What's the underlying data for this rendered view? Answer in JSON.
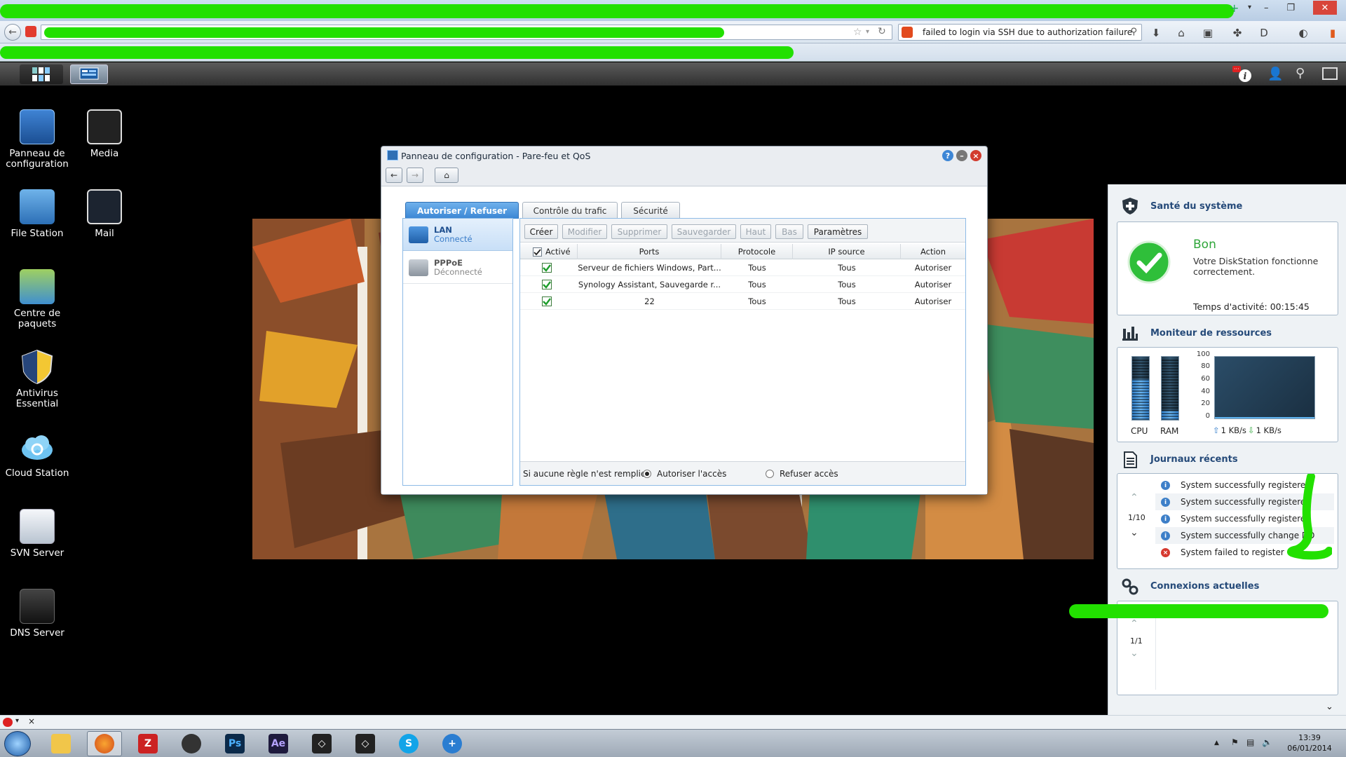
{
  "browser": {
    "search_value": "failed to login via SSH due to authorization failure",
    "close_glyph": "✕",
    "min_glyph": "–",
    "max_glyph": "❐"
  },
  "dsm": {
    "notification_count": "···"
  },
  "desktop_icons": [
    {
      "label": "Panneau de configuration"
    },
    {
      "label": "Media"
    },
    {
      "label": "File Station"
    },
    {
      "label": "Mail"
    },
    {
      "label": "Centre de paquets"
    },
    {
      "label": "Antivirus Essential"
    },
    {
      "label": "Cloud Station"
    },
    {
      "label": "SVN Server"
    },
    {
      "label": "DNS Server"
    }
  ],
  "dialog": {
    "title": "Panneau de configuration - Pare-feu et QoS",
    "tabs": [
      "Autoriser / Refuser",
      "Contrôle du trafic",
      "Sécurité"
    ],
    "interfaces": [
      {
        "name": "LAN",
        "status": "Connecté"
      },
      {
        "name": "PPPoE",
        "status": "Déconnecté"
      }
    ],
    "toolbar": {
      "create": "Créer",
      "edit": "Modifier",
      "delete": "Supprimer",
      "save": "Sauvegarder",
      "up": "Haut",
      "down": "Bas",
      "settings": "Paramètres"
    },
    "columns": {
      "enabled": "Activé",
      "ports": "Ports",
      "protocol": "Protocole",
      "source_ip": "IP source",
      "action": "Action"
    },
    "rules": [
      {
        "ports": "Serveur de fichiers Windows, Part...",
        "protocol": "Tous",
        "source_ip": "Tous",
        "action": "Autoriser"
      },
      {
        "ports": "Synology Assistant, Sauvegarde r...",
        "protocol": "Tous",
        "source_ip": "Tous",
        "action": "Autoriser"
      },
      {
        "ports": "22",
        "protocol": "Tous",
        "source_ip": "Tous",
        "action": "Autoriser"
      }
    ],
    "footer": {
      "label": "Si aucune règle n'est remplie:",
      "allow": "Autoriser l'accès",
      "deny": "Refuser accès"
    }
  },
  "widgets": {
    "health": {
      "title": "Santé du système",
      "status": "Bon",
      "message": "Votre DiskStation fonctionne correctement.",
      "uptime": "Temps d'activité: 00:15:45"
    },
    "resources": {
      "title": "Moniteur de ressources",
      "cpu_label": "CPU",
      "ram_label": "RAM",
      "cpu_level": 0.65,
      "ram_level": 0.15,
      "axis_ticks": [
        "100",
        "80",
        "60",
        "40",
        "20",
        "0"
      ],
      "upload": "1 KB/s",
      "download": "1 KB/s"
    },
    "logs": {
      "title": "Journaux récents",
      "page": "1/10",
      "entries": [
        {
          "text": "System successfully registered",
          "level": "info"
        },
        {
          "text": "System successfully registered",
          "level": "info"
        },
        {
          "text": "System successfully registered",
          "level": "info"
        },
        {
          "text": "System successfully change DD",
          "level": "info"
        },
        {
          "text": "System failed to register",
          "level": "error"
        }
      ]
    },
    "connections": {
      "title": "Connexions actuelles",
      "page": "1/1"
    }
  },
  "clock": {
    "time": "13:39",
    "date": "06/01/2014"
  },
  "colors": {
    "accent": "#3a86d4",
    "ok_green": "#2fbf3a",
    "error_red": "#d6392f",
    "redaction_green": "#22e000"
  }
}
